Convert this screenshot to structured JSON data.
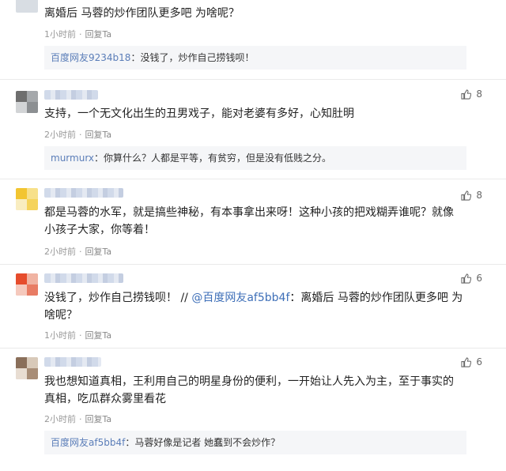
{
  "comments": [
    {
      "text": "离婚后 马蓉的炒作团队更多吧 为啥呢？",
      "time": "1小时前",
      "reply_label": "回复Ta",
      "sub_reply": {
        "name": "百度网友9234b18",
        "text": "：没钱了，炒作自己捞钱呗！"
      }
    },
    {
      "likes": "8",
      "text": "支持，一个无文化出生的丑男戏子，能对老婆有多好，心知肚明",
      "time": "2小时前",
      "reply_label": "回复Ta",
      "sub_reply": {
        "name": "murmurx",
        "text": "：你算什么？人都是平等，有贫穷，但是没有低贱之分。"
      }
    },
    {
      "likes": "8",
      "text_line1": "都是马蓉的水军，就是搞些神秘，有本事拿出来呀！这种小孩的把戏糊弄谁呢？就像",
      "text_line2": "小孩子大家，你等着！",
      "time": "2小时前",
      "reply_label": "回复Ta"
    },
    {
      "likes": "6",
      "text_line1_a": "没钱了，炒作自己捞钱呗！ // ",
      "mention": "@百度网友af5bb4f",
      "text_line1_b": "：离婚后 马蓉的炒作团队更多吧 为",
      "text_line2": "啥呢？",
      "time": "1小时前",
      "reply_label": "回复Ta"
    },
    {
      "likes": "6",
      "text_line1": "我也想知道真相，王利用自己的明星身份的便利，一开始让人先入为主，至于事实的",
      "text_line2": "真相，吃瓜群众雾里看花",
      "time": "2小时前",
      "reply_label": "回复Ta",
      "sub_reply": {
        "name": "百度网友af5bb4f",
        "text": "：马蓉好像是记者 她蠢到不会炒作？"
      }
    }
  ],
  "meta_separator": "·",
  "colors": {
    "link": "#5a7db8",
    "mention": "#3e6fb8",
    "subreply_bg": "#f5f6f8"
  }
}
